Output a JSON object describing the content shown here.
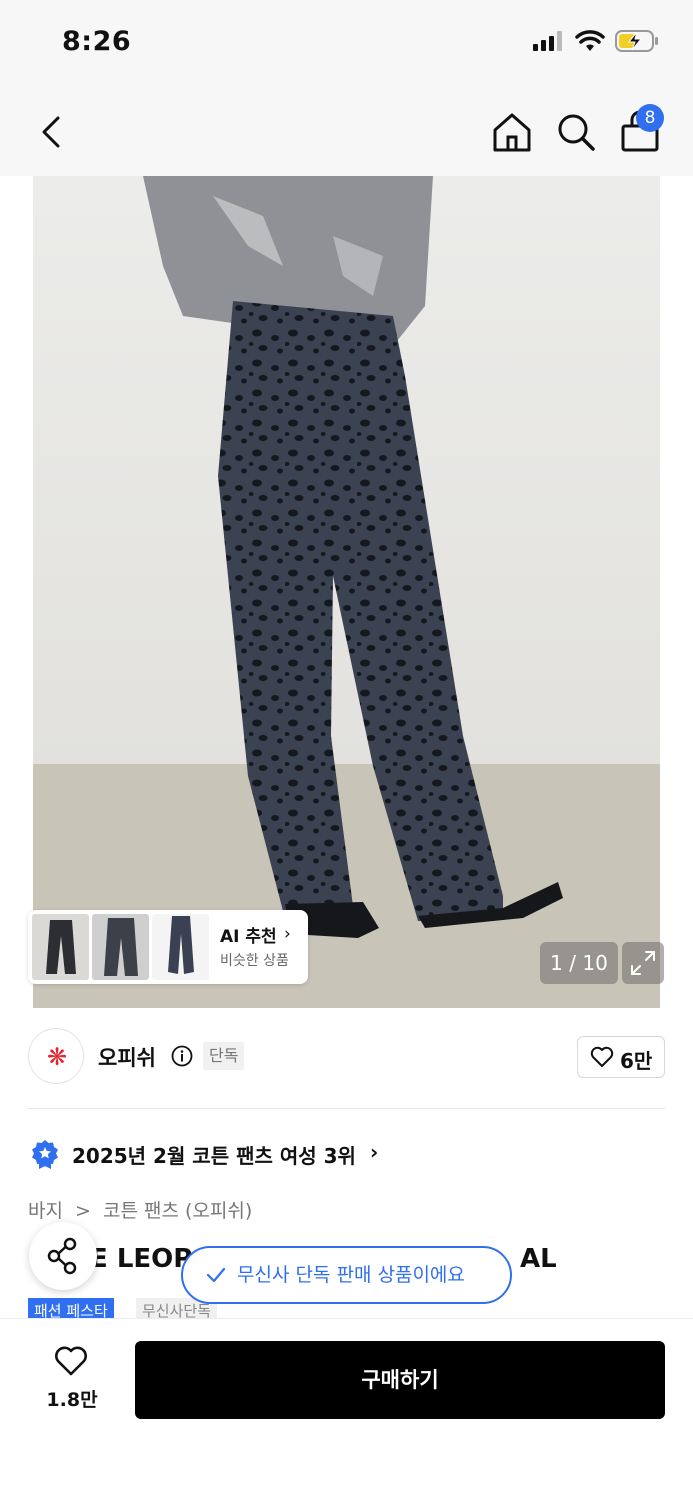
{
  "status_bar": {
    "time": "8:26",
    "icons": [
      "signal-icon",
      "wifi-icon",
      "battery-charging-icon"
    ]
  },
  "nav": {
    "cart_count": "8",
    "icons": [
      "back-icon",
      "home-icon",
      "search-icon",
      "cart-icon"
    ]
  },
  "gallery": {
    "counter": "1 / 10",
    "ai_title": "AI 추천",
    "ai_chevron": "›",
    "ai_subtitle": "비슷한 상품"
  },
  "brand": {
    "logo_glyph": "❋",
    "name": "오피쉬",
    "exclusive_label": "단독",
    "like_count": "6만"
  },
  "ranking": {
    "text": "2025년 2월 코튼 팬츠 여성 3위",
    "chevron": "›"
  },
  "breadcrumb": {
    "category": "바지",
    "separator": ">",
    "subcategory": "코튼 팬츠 (오피쉬)"
  },
  "product": {
    "title_left": "E LEOP",
    "title_right": "AL"
  },
  "toast": {
    "text": "무신사 단독 판매 상품이에요"
  },
  "tags": {
    "fest": "패션 페스타",
    "exclusive": "무신사단독"
  },
  "bottom": {
    "wish_count": "1.8만",
    "buy_label": "구매하기"
  },
  "colors": {
    "accent": "#2f6ff0",
    "brand_logo": "#e0262f",
    "buy_button": "#000000"
  }
}
